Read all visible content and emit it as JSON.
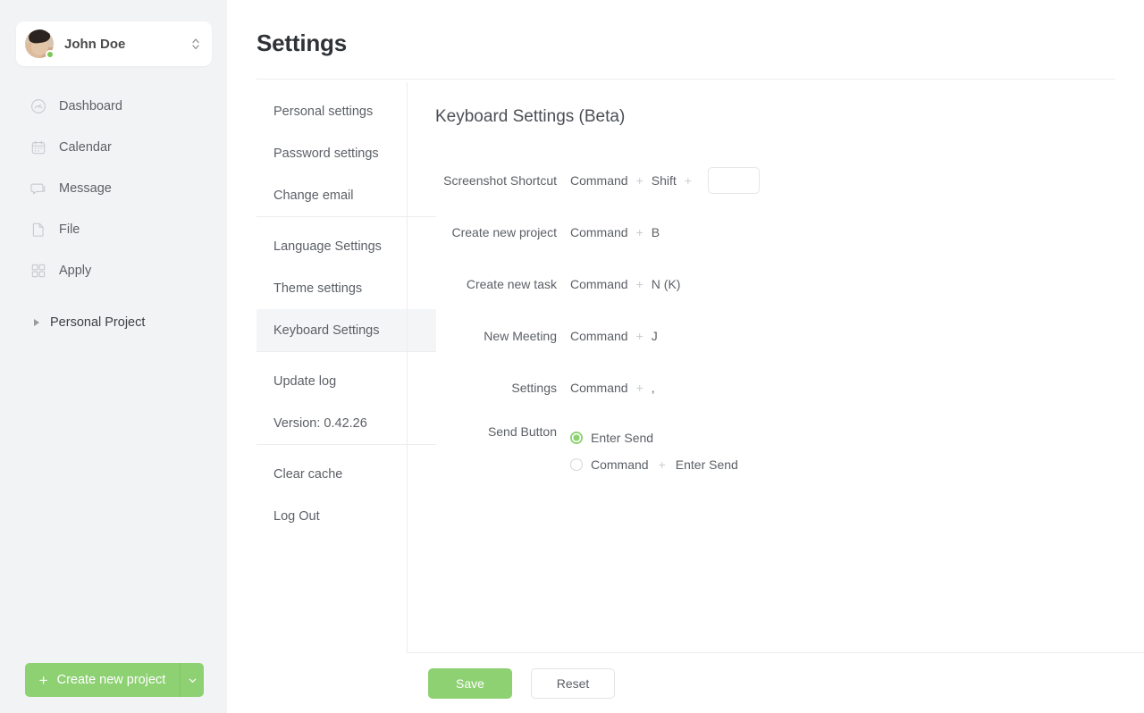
{
  "sidebar": {
    "user": {
      "name": "John Doe",
      "avatar": "user-avatar-photo",
      "status": "online",
      "switcher_icon": "chevron-up-down-icon"
    },
    "items": [
      {
        "label": "Dashboard",
        "icon": "dashboard-icon"
      },
      {
        "label": "Calendar",
        "icon": "calendar-icon"
      },
      {
        "label": "Message",
        "icon": "message-icon"
      },
      {
        "label": "File",
        "icon": "file-icon"
      },
      {
        "label": "Apply",
        "icon": "apply-grid-icon"
      }
    ],
    "project": {
      "label": "Personal Project",
      "icon": "triangle-right-icon"
    },
    "create_button": {
      "label": "Create new project",
      "plus_icon": "plus-icon",
      "caret_icon": "chevron-down-icon"
    }
  },
  "header": {
    "title": "Settings"
  },
  "settings_nav": {
    "groups": [
      [
        {
          "label": "Personal settings",
          "active": false
        },
        {
          "label": "Password settings",
          "active": false
        },
        {
          "label": "Change email",
          "active": false
        }
      ],
      [
        {
          "label": "Language Settings",
          "active": false
        },
        {
          "label": "Theme settings",
          "active": false
        },
        {
          "label": "Keyboard Settings",
          "active": true
        }
      ],
      [
        {
          "label": "Update log",
          "active": false
        },
        {
          "label": "Version: 0.42.26",
          "active": false
        }
      ],
      [
        {
          "label": "Clear cache",
          "active": false
        },
        {
          "label": "Log Out",
          "active": false
        }
      ]
    ]
  },
  "content": {
    "title": "Keyboard Settings (Beta)",
    "plus_symbol": "+",
    "shortcuts": [
      {
        "label": "Screenshot Shortcut",
        "keys": [
          "Command",
          "Shift"
        ],
        "input": {
          "value": "",
          "placeholder": ""
        }
      },
      {
        "label": "Create new project",
        "keys": [
          "Command",
          "B"
        ],
        "input": null
      },
      {
        "label": "Create new task",
        "keys": [
          "Command",
          "N (K)"
        ],
        "input": null
      },
      {
        "label": "New Meeting",
        "keys": [
          "Command",
          "J"
        ],
        "input": null
      },
      {
        "label": "Settings",
        "keys": [
          "Command",
          ","
        ],
        "input": null
      }
    ],
    "send_button": {
      "label": "Send Button",
      "options": [
        {
          "parts": [
            "Enter Send"
          ],
          "selected": true
        },
        {
          "parts": [
            "Command",
            "Enter Send"
          ],
          "selected": false
        }
      ]
    },
    "actions": {
      "save_label": "Save",
      "reset_label": "Reset"
    }
  },
  "colors": {
    "accent_green": "#8ed173",
    "sidebar_bg": "#f2f3f5",
    "active_item_bg": "#f4f5f7",
    "divider": "#ededee",
    "text": "#5c6066",
    "title_text": "#2f3337"
  }
}
